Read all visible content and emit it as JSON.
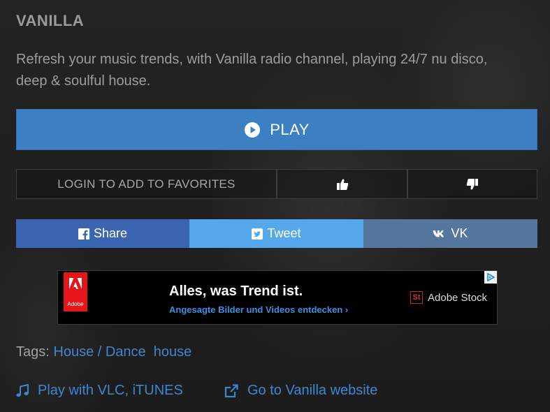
{
  "station": {
    "title": "VANILLA",
    "description": "Refresh your music trends, with Vanilla radio channel, playing 24/7 nu disco, deep & soulful house."
  },
  "player": {
    "play_label": "PLAY"
  },
  "favorites": {
    "login_label": "LOGIN TO ADD TO FAVORITES"
  },
  "share": {
    "facebook": "Share",
    "twitter": "Tweet",
    "vk": "VK"
  },
  "ad": {
    "logo_label": "Adobe",
    "headline": "Alles, was Trend ist.",
    "subline": "Angesagte Bilder und Videos entdecken ›",
    "brand_badge": "St",
    "brand": "Adobe Stock"
  },
  "tags": {
    "label": "Tags:",
    "items": [
      "House / Dance",
      "house"
    ]
  },
  "links": {
    "vlc": "Play with VLC, iTUNES",
    "website": "Go to Vanilla website"
  },
  "colors": {
    "play": "#3d7fc3",
    "facebook": "#3b65b1",
    "twitter": "#55a8ec",
    "vk": "#56769d",
    "link": "#3f86cf"
  }
}
